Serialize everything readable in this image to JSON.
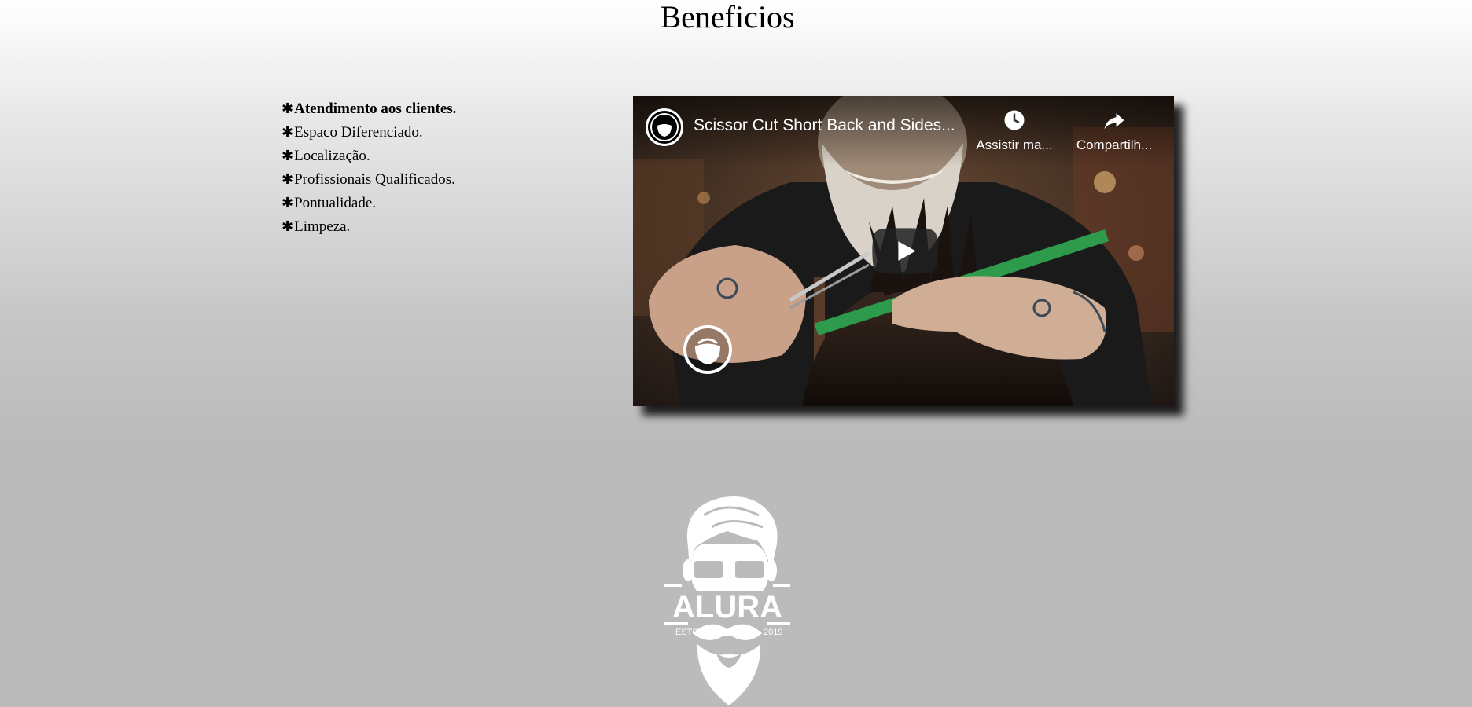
{
  "page": {
    "title": "Beneficios"
  },
  "benefits": {
    "bullet": "✱",
    "items": [
      "Atendimento aos clientes.",
      "Espaco Diferenciado.",
      "Localização.",
      "Profissionais Qualificados.",
      "Pontualidade.",
      "Limpeza."
    ]
  },
  "video": {
    "title": "Scissor Cut Short Back and Sides...",
    "watch_later_label": "Assistir ma...",
    "share_label": "Compartilh...",
    "icons": {
      "watch_later": "clock-icon",
      "share": "share-icon",
      "play": "play-icon",
      "channel": "beard-logo-icon"
    }
  },
  "logo": {
    "text": "ALURA",
    "left_text": "ESTO",
    "right_text": "2019"
  },
  "colors": {
    "play_button": "#212121",
    "text": "#000000",
    "logo": "#ffffff"
  }
}
